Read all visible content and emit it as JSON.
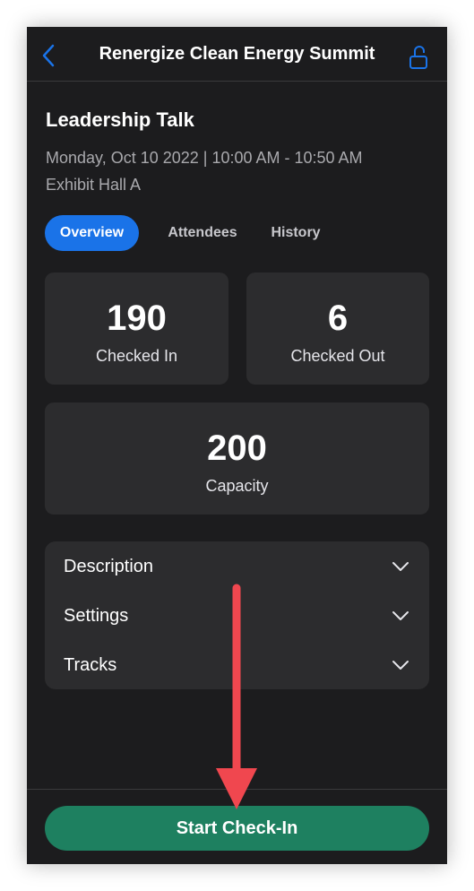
{
  "nav": {
    "title": "Renergize Clean Energy Summit",
    "back_icon": "chevron-left-icon",
    "lock_icon": "unlocked-padlock-icon"
  },
  "session": {
    "title": "Leadership Talk",
    "when": "Monday, Oct 10 2022 | 10:00 AM - 10:50 AM",
    "location": "Exhibit Hall A"
  },
  "tabs": [
    {
      "label": "Overview",
      "active": true
    },
    {
      "label": "Attendees",
      "active": false
    },
    {
      "label": "History",
      "active": false
    }
  ],
  "stats": {
    "checked_in": {
      "value": "190",
      "label": "Checked In"
    },
    "checked_out": {
      "value": "6",
      "label": "Checked Out"
    },
    "capacity": {
      "value": "200",
      "label": "Capacity"
    }
  },
  "sections": [
    {
      "label": "Description",
      "icon": "chevron-down-icon"
    },
    {
      "label": "Settings",
      "icon": "chevron-down-icon"
    },
    {
      "label": "Tracks",
      "icon": "chevron-down-icon"
    }
  ],
  "footer": {
    "start_label": "Start Check-In"
  },
  "colors": {
    "background": "#1c1c1e",
    "card": "#2c2c2e",
    "accent_blue": "#1a73e8",
    "button_green": "#1e8060",
    "annotation_arrow": "#f0474f"
  }
}
